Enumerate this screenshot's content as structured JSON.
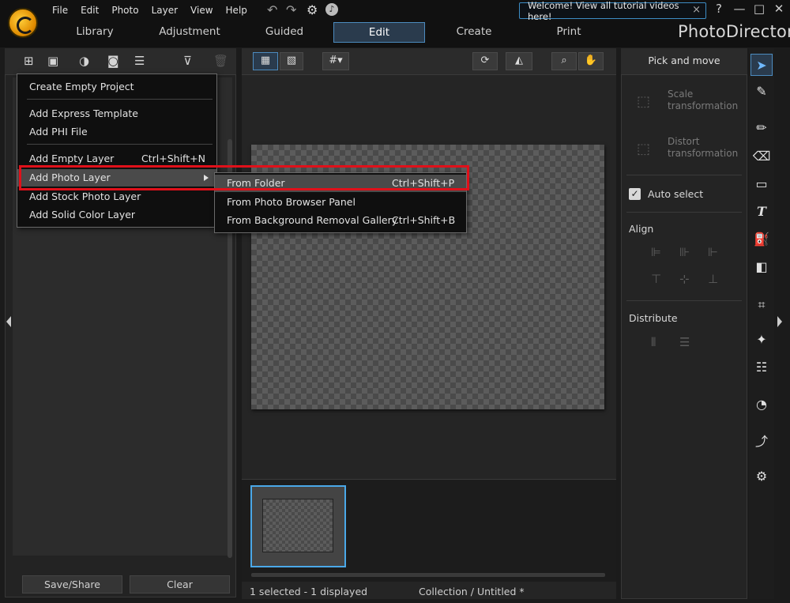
{
  "menubar": [
    "File",
    "Edit",
    "Photo",
    "Layer",
    "View",
    "Help"
  ],
  "welcome": {
    "text": "Welcome! View all tutorial videos here!",
    "close": "×"
  },
  "window_buttons": {
    "help": "?",
    "minimize": "—",
    "maximize": "□",
    "close": "✕"
  },
  "tabs": [
    {
      "label": "Library"
    },
    {
      "label": "Adjustment"
    },
    {
      "label": "Guided"
    },
    {
      "label": "Edit"
    },
    {
      "label": "Create"
    },
    {
      "label": "Print"
    }
  ],
  "brand": "PhotoDirector",
  "main_menu": {
    "items": [
      {
        "label": "Create Empty Project",
        "shortcut": ""
      },
      {
        "label": "Add Express Template",
        "shortcut": ""
      },
      {
        "label": "Add PHI File",
        "shortcut": ""
      },
      {
        "label": "Add Empty Layer",
        "shortcut": "Ctrl+Shift+N"
      },
      {
        "label": "Add Photo Layer",
        "shortcut": ""
      },
      {
        "label": "Add Stock Photo Layer",
        "shortcut": ""
      },
      {
        "label": "Add Solid Color Layer",
        "shortcut": ""
      }
    ]
  },
  "submenu": {
    "items": [
      {
        "label": "From Folder",
        "shortcut": "Ctrl+Shift+P"
      },
      {
        "label": "From Photo Browser Panel",
        "shortcut": ""
      },
      {
        "label": "From Background Removal Gallery",
        "shortcut": "Ctrl+Shift+B"
      }
    ]
  },
  "left_bottom": {
    "save": "Save/Share",
    "clear": "Clear"
  },
  "status": {
    "selection": "1 selected - 1 displayed",
    "collection": "Collection / Untitled *"
  },
  "right_panel": {
    "title": "Pick and move",
    "scale": "Scale transformation",
    "distort": "Distort transformation",
    "auto_select": "Auto select",
    "align": "Align",
    "distribute": "Distribute"
  },
  "colors": {
    "accent": "#4c8bbf",
    "highlight_box": "#e0101a",
    "thumb_border": "#4aa8e8"
  }
}
